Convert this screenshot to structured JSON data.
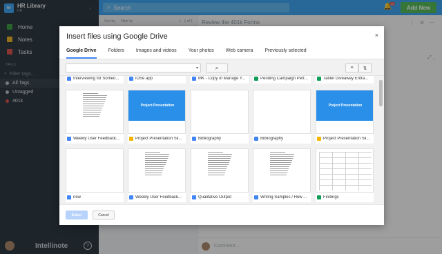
{
  "sidebar": {
    "brand": {
      "logo": "hr",
      "name": "HR Library",
      "sub": "HR"
    },
    "nav": [
      {
        "label": "Home",
        "icon": "home-icon"
      },
      {
        "label": "Notes",
        "icon": "notes-icon"
      },
      {
        "label": "Tasks",
        "icon": "tasks-icon"
      }
    ],
    "tags_header": "TAGS",
    "tag_filter_placeholder": "Filter tags...",
    "tags": [
      {
        "label": "All Tags"
      },
      {
        "label": "Untagged"
      },
      {
        "label": "401k"
      }
    ],
    "footer_brand": "Intellinote",
    "help": "?"
  },
  "topbar": {
    "search_placeholder": "Search",
    "notification_count": "40",
    "add_new": "Add New"
  },
  "list": {
    "sort": "Sort by",
    "filter": "Filter by",
    "pager": "1 - 1 of 1"
  },
  "detail": {
    "title": "Review the 401k Forms",
    "comment_placeholder": "Comment..."
  },
  "modal": {
    "title": "Insert files using Google Drive",
    "close": "×",
    "tabs": [
      "Google Drive",
      "Folders",
      "Images and videos",
      "Your photos",
      "Web camera",
      "Previously selected"
    ],
    "active_tab": "Google Drive",
    "select_label": "Select",
    "cancel_label": "Cancel",
    "top_row": [
      {
        "name": "Interviewing for Someo...",
        "type": "doc"
      },
      {
        "name": "iOSe app",
        "type": "doc"
      },
      {
        "name": "MK - Copy of Manage Y...",
        "type": "doc"
      },
      {
        "name": "Pending Campaign Perf...",
        "type": "sheet"
      },
      {
        "name": "Tablet Giveaway Entra...",
        "type": "sheet"
      }
    ],
    "files": [
      {
        "name": "Weekly User Feedback...",
        "type": "doc",
        "thumb": "doc"
      },
      {
        "name": "Project Presentation Sli...",
        "type": "slide",
        "thumb": "pres",
        "thumb_title": "Project Presentation"
      },
      {
        "name": "Bibliography",
        "type": "doc",
        "thumb": "blank"
      },
      {
        "name": "Bibliography",
        "type": "doc",
        "thumb": "blank"
      },
      {
        "name": "Project Presentation Sli...",
        "type": "slide",
        "thumb": "pres",
        "thumb_title": "Project Presentation"
      },
      {
        "name": "new",
        "type": "doc",
        "thumb": "blank"
      },
      {
        "name": "Weekly User Feedback...",
        "type": "doc",
        "thumb": "doc"
      },
      {
        "name": "Qualitative Output",
        "type": "doc",
        "thumb": "doc"
      },
      {
        "name": "Writing Samples / How ...",
        "type": "doc",
        "thumb": "doc"
      },
      {
        "name": "Findings",
        "type": "sheet",
        "thumb": "sheet"
      }
    ]
  }
}
